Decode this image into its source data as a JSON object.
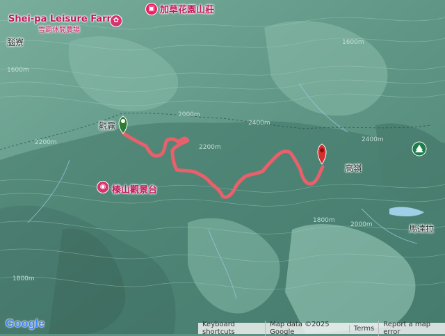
{
  "labels": {
    "farm_en": "Shei-pa Leisure Farm",
    "farm_zh": "雪霸休閒農場",
    "hotel": "加草花園山莊",
    "poi_north_west": "腦寮",
    "start": "觀霧",
    "viewpoint": "榛山觀景台",
    "end": "高嶺",
    "east": "馬達拉"
  },
  "contour_labels": [
    "2000m",
    "2400m",
    "2200m",
    "1800m",
    "2000m",
    "1600m",
    "2400m",
    "2200m",
    "1800m",
    "1600m"
  ],
  "icons": {
    "start_marker": "green-flag-pin",
    "end_marker": "red-pin",
    "farm": "leisure-farm-icon",
    "hotel": "hotel-icon",
    "viewpoint": "camera-icon",
    "tree": "tree-icon"
  },
  "route": {
    "color": "#e8606b"
  },
  "footer": {
    "shortcuts": "Keyboard shortcuts",
    "mapdata": "Map data ©2025 Google",
    "terms": "Terms",
    "report": "Report a map error"
  },
  "logo": "Google"
}
